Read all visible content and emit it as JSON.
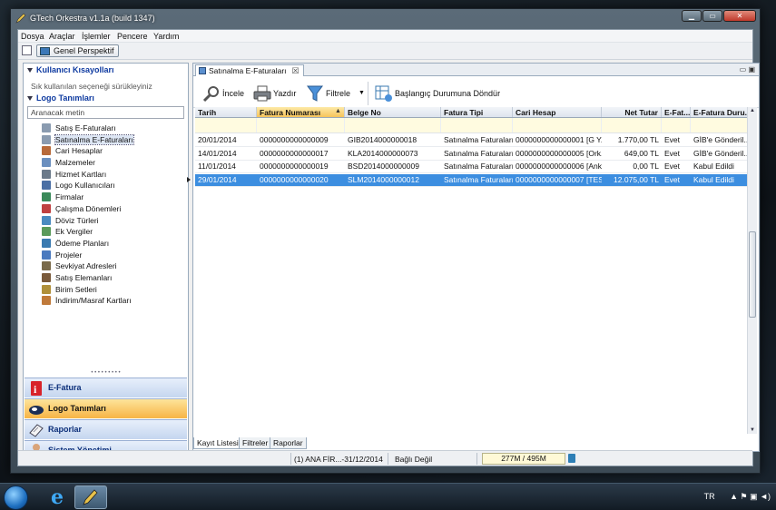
{
  "window": {
    "title": "GTech Orkestra v1.1a (build 1347)",
    "minimize": "▁",
    "maximize": "▭",
    "close": "✕"
  },
  "menu": [
    "Dosya",
    "Araçlar",
    "İşlemler",
    "Pencere",
    "Yardım"
  ],
  "perspective": {
    "label": "Genel Perspektif"
  },
  "left_panel": {
    "shortcuts_title": "Kullanıcı Kısayolları",
    "shortcuts_hint": "Sık kullanılan seçeneği sürükleyiniz",
    "logo_title": "Logo Tanımları",
    "search_placeholder": "Aranacak metin",
    "tree": [
      {
        "label": "Satış E-Faturaları",
        "icon": "invoice-icon",
        "color": "#8a9bb0"
      },
      {
        "label": "Satınalma E-Faturaları",
        "icon": "invoice-icon",
        "color": "#8a9bb0",
        "selected": true
      },
      {
        "label": "Cari Hesaplar",
        "icon": "users-icon",
        "color": "#b86a3a"
      },
      {
        "label": "Malzemeler",
        "icon": "box-icon",
        "color": "#6b8fbf"
      },
      {
        "label": "Hizmet Kartları",
        "icon": "service-icon",
        "color": "#6b7a8a"
      },
      {
        "label": "Logo Kullanıcıları",
        "icon": "user-icon",
        "color": "#4a6fa5"
      },
      {
        "label": "Firmalar",
        "icon": "company-icon",
        "color": "#3a8a5a"
      },
      {
        "label": "Çalışma Dönemleri",
        "icon": "calendar-icon",
        "color": "#c04040"
      },
      {
        "label": "Döviz Türleri",
        "icon": "currency-icon",
        "color": "#4a8ac0"
      },
      {
        "label": "Ek Vergiler",
        "icon": "tax-icon",
        "color": "#5a9a5a"
      },
      {
        "label": "Ödeme Planları",
        "icon": "payment-icon",
        "color": "#3a7ab0"
      },
      {
        "label": "Projeler",
        "icon": "project-icon",
        "color": "#4a7abf"
      },
      {
        "label": "Sevkiyat Adresleri",
        "icon": "truck-icon",
        "color": "#7a6a4a"
      },
      {
        "label": "Satış Elemanları",
        "icon": "person-icon",
        "color": "#7a5a3a"
      },
      {
        "label": "Birim Setleri",
        "icon": "unit-icon",
        "color": "#b0903a"
      },
      {
        "label": "İndirim/Masraf Kartları",
        "icon": "discount-icon",
        "color": "#c07a3a"
      }
    ],
    "nav": [
      {
        "label": "E-Fatura",
        "icon": "e-invoice-icon",
        "active": false
      },
      {
        "label": "Logo Tanımları",
        "icon": "logo-icon",
        "active": true
      },
      {
        "label": "Raporlar",
        "icon": "report-icon",
        "active": false
      },
      {
        "label": "Sistem Yönetimi",
        "icon": "admin-icon",
        "active": false
      }
    ]
  },
  "tab": {
    "label": "Satınalma E-Faturaları",
    "close": "☒",
    "view_controls": "▭ ▣"
  },
  "toolbar": {
    "inspect": "İncele",
    "print": "Yazdır",
    "filter": "Filtrele",
    "reset": "Başlangıç Durumuna Döndür"
  },
  "grid": {
    "columns": [
      "Tarih",
      "Fatura Numarası",
      "Belge No",
      "Fatura Tipi",
      "Cari Hesap",
      "Net Tutar",
      "E-Fat...",
      "E-Fatura Duru..."
    ],
    "rows": [
      [
        "20/01/2014",
        "0000000000000009",
        "GIB2014000000018",
        "Satınalma Faturaları",
        "0000000000000001 [G Y...",
        "1.770,00 TL",
        "Evet",
        "GİB'e Gönderil..."
      ],
      [
        "14/01/2014",
        "0000000000000017",
        "KLA2014000000073",
        "Satınalma Faturaları",
        "0000000000000005 [Ork...",
        "649,00 TL",
        "Evet",
        "GİB'e Gönderil..."
      ],
      [
        "11/01/2014",
        "0000000000000019",
        "BSD2014000000009",
        "Satınalma Faturaları",
        "0000000000000006 [Ank...",
        "0,00 TL",
        "Evet",
        "Kabul Edildi"
      ],
      [
        "29/01/2014",
        "0000000000000020",
        "SLM2014000000012",
        "Satınalma Faturaları",
        "0000000000000007 [TES...",
        "12.075,00 TL",
        "Evet",
        "Kabul Edildi"
      ]
    ],
    "selected_row": 3
  },
  "bottom_tabs": [
    "Kayıt Listesi",
    "Filtreler",
    "Raporlar"
  ],
  "status": {
    "period": "(1) ANA FİR...-31/12/2014",
    "connection": "Bağlı Değil",
    "memory": "277M / 495M"
  },
  "taskbar": {
    "lang": "TR",
    "tray_icons": "▲  ⚑  ▣  ◄)"
  },
  "colors": {
    "accent": "#3c8ee0",
    "active_nav": "#f7b445",
    "section_head": "#0e3aa0"
  }
}
